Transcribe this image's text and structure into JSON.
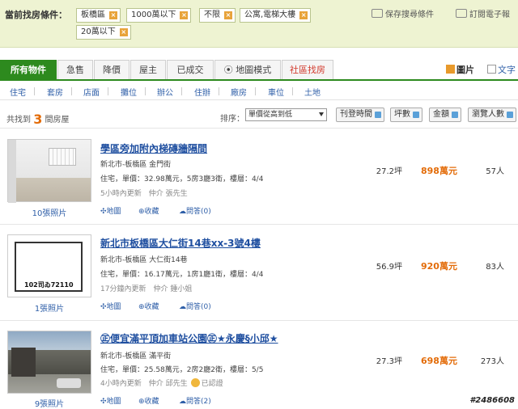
{
  "filter": {
    "label": "當前找房條件：",
    "chips": [
      "板橋區",
      "1000萬以下",
      "不限",
      "公寓,電梯大樓",
      "20萬以下"
    ],
    "remove_glyph": "×",
    "save_search": "保存搜尋條件",
    "subscribe": "訂閱電子報"
  },
  "tabs": [
    "所有物件",
    "急售",
    "降價",
    "屋主",
    "已成交",
    "地圖模式",
    "社區找房"
  ],
  "view": {
    "pic": "圖片",
    "text": "文字"
  },
  "subnav": [
    "住宅",
    "套房",
    "店面",
    "攤位",
    "辦公",
    "住辦",
    "廠房",
    "車位",
    "土地"
  ],
  "results": {
    "prefix": "共找到",
    "count": "3",
    "suffix": "間房屋"
  },
  "sort": {
    "label": "排序：",
    "selected": "單價從高到低",
    "buttons": [
      "刊登時間",
      "坪數",
      "金額",
      "瀏覽人數"
    ]
  },
  "listings": [
    {
      "title": "學區旁加附內梯磚牆隔間",
      "address": "新北市-板橋區 金門街",
      "info": "住宅，單價：32.98萬元，5房3廳3衛，樓層：4/4",
      "meta": "5小時內更新　仲介 張先生",
      "badge": "",
      "area": "27.2坪",
      "price": "898萬元",
      "views": "57人",
      "photos": "10張照片",
      "map": "地圖",
      "fav": "收藏",
      "qa": "問答(0)"
    },
    {
      "title": "新北市板橋區大仁街14巷xx-3號4樓",
      "address": "新北市-板橋區 大仁街14巷",
      "info": "住宅，單價：16.17萬元，1房1廳1衛，樓層：4/4",
      "meta": "17分鐘內更新　仲介 鍾小姐",
      "badge": "",
      "area": "56.9坪",
      "price": "920萬元",
      "views": "83人",
      "photos": "1張照片",
      "map": "地圖",
      "fav": "收藏",
      "qa": "問答(0)",
      "thumb_text": "102司ゐ72110"
    },
    {
      "title": "㊣便宜滿平頂加車站公園㊣★永慶§小邱★",
      "address": "新北市-板橋區 滿平街",
      "info": "住宅，單價：25.58萬元，2房2廳2衛，樓層：5/5",
      "meta": "4小時內更新　仲介 邱先生",
      "badge": "已認證",
      "area": "27.3坪",
      "price": "698萬元",
      "views": "273人",
      "photos": "9張照片",
      "map": "地圖",
      "fav": "收藏",
      "qa": "問答(2)"
    }
  ],
  "watermark": "#2486608"
}
